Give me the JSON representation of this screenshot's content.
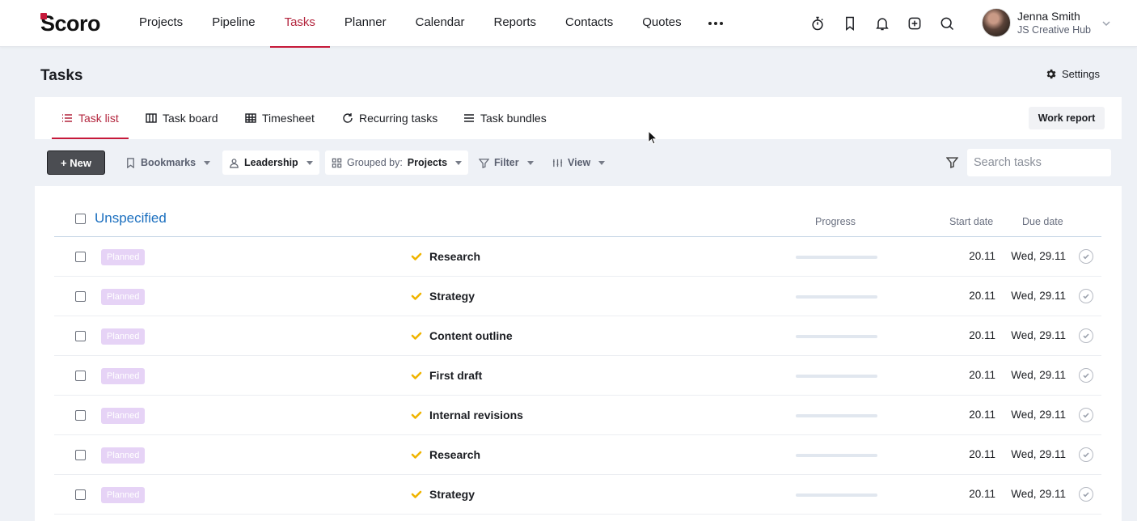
{
  "app": {
    "logo_text": "Scoro",
    "brand_color": "#c6193a",
    "link_color": "#1b6fbf"
  },
  "nav": {
    "items": [
      {
        "label": "Projects",
        "active": false
      },
      {
        "label": "Pipeline",
        "active": false
      },
      {
        "label": "Tasks",
        "active": true
      },
      {
        "label": "Planner",
        "active": false
      },
      {
        "label": "Calendar",
        "active": false
      },
      {
        "label": "Reports",
        "active": false
      },
      {
        "label": "Contacts",
        "active": false
      },
      {
        "label": "Quotes",
        "active": false
      }
    ],
    "more_icon": "more-horizontal-icon",
    "icons": [
      "stopwatch-icon",
      "bookmark-icon",
      "bell-icon",
      "add-square-icon",
      "search-icon"
    ]
  },
  "user": {
    "name": "Jenna Smith",
    "organization": "JS Creative Hub"
  },
  "page": {
    "title": "Tasks",
    "settings_label": "Settings"
  },
  "subtabs": {
    "items": [
      {
        "label": "Task list",
        "icon": "list-icon",
        "active": true
      },
      {
        "label": "Task board",
        "icon": "board-icon",
        "active": false
      },
      {
        "label": "Timesheet",
        "icon": "grid-icon",
        "active": false
      },
      {
        "label": "Recurring tasks",
        "icon": "refresh-icon",
        "active": false
      },
      {
        "label": "Task bundles",
        "icon": "stack-icon",
        "active": false
      }
    ],
    "work_report_label": "Work report"
  },
  "toolbar": {
    "new_label": "+ New",
    "bookmarks_label": "Bookmarks",
    "leadership_label": "Leadership",
    "grouped_prefix": "Grouped by:",
    "grouped_value": "Projects",
    "filter_label": "Filter",
    "view_label": "View",
    "search_placeholder": "Search tasks"
  },
  "table": {
    "group_title": "Unspecified",
    "columns": {
      "progress": "Progress",
      "start_date": "Start date",
      "due_date": "Due date"
    },
    "rows": [
      {
        "status": "Planned",
        "name": "Research",
        "progress": 0,
        "start": "20.11",
        "due": "Wed, 29.11"
      },
      {
        "status": "Planned",
        "name": "Strategy",
        "progress": 0,
        "start": "20.11",
        "due": "Wed, 29.11"
      },
      {
        "status": "Planned",
        "name": "Content outline",
        "progress": 0,
        "start": "20.11",
        "due": "Wed, 29.11"
      },
      {
        "status": "Planned",
        "name": "First draft",
        "progress": 0,
        "start": "20.11",
        "due": "Wed, 29.11"
      },
      {
        "status": "Planned",
        "name": "Internal revisions",
        "progress": 0,
        "start": "20.11",
        "due": "Wed, 29.11"
      },
      {
        "status": "Planned",
        "name": "Research",
        "progress": 0,
        "start": "20.11",
        "due": "Wed, 29.11"
      },
      {
        "status": "Planned",
        "name": "Strategy",
        "progress": 0,
        "start": "20.11",
        "due": "Wed, 29.11"
      }
    ]
  }
}
